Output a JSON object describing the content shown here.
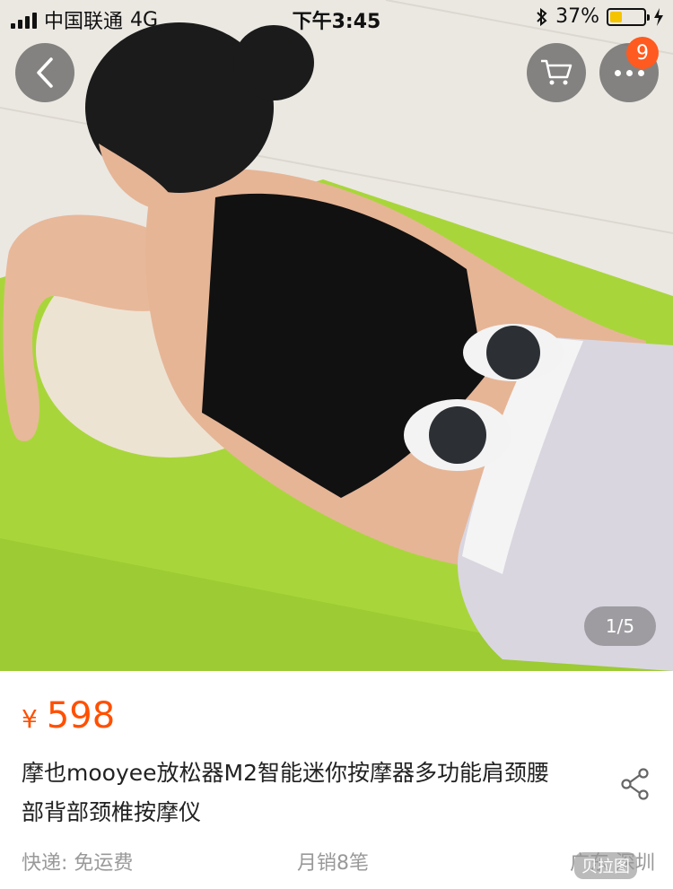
{
  "status_bar": {
    "carrier": "中国联通",
    "network": "4G",
    "time": "下午3:45",
    "battery_percent": "37%",
    "battery_level": 0.37,
    "icons": [
      "signal-icon",
      "bluetooth-icon",
      "battery-icon",
      "charging-icon"
    ]
  },
  "nav": {
    "back_icon": "chevron-left-icon",
    "cart_icon": "cart-icon",
    "more_icon": "more-dots-icon",
    "notification_count": "9"
  },
  "gallery": {
    "page_indicator": "1/5",
    "image_subject": "product-photo-massager"
  },
  "product": {
    "currency_symbol": "¥",
    "price": "598",
    "title": "摩也mooyee放松器M2智能迷你按摩器多功能肩颈腰部背部颈椎按摩仪",
    "share_icon": "share-icon"
  },
  "meta": {
    "shipping": "快递: 免运费",
    "monthly_sales": "月销8笔",
    "location": "广东 深圳"
  },
  "watermark": {
    "text": "贝拉图"
  },
  "colors": {
    "accent": "#ff5000",
    "badge": "#ff5a1f",
    "mat_green": "#a8d63a",
    "muted_text": "#999999"
  }
}
